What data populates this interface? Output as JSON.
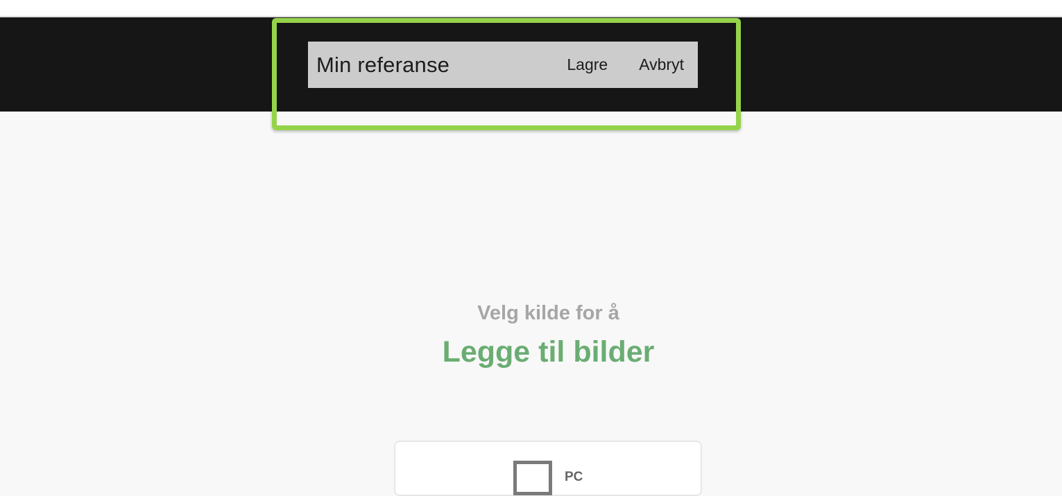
{
  "header": {
    "title": "Min referanse",
    "save_label": "Lagre",
    "cancel_label": "Avbryt"
  },
  "main": {
    "subheading": "Velg kilde for å",
    "heading": "Legge til bilder",
    "sources": [
      {
        "label": "PC",
        "icon": "monitor-icon"
      }
    ]
  },
  "colors": {
    "header_bg": "#161616",
    "titlebar_bg": "#cccccc",
    "highlight": "#95d34b",
    "heading": "#6aad73",
    "subheading": "#a6a6a6",
    "page_bg": "#f8f8f8"
  }
}
